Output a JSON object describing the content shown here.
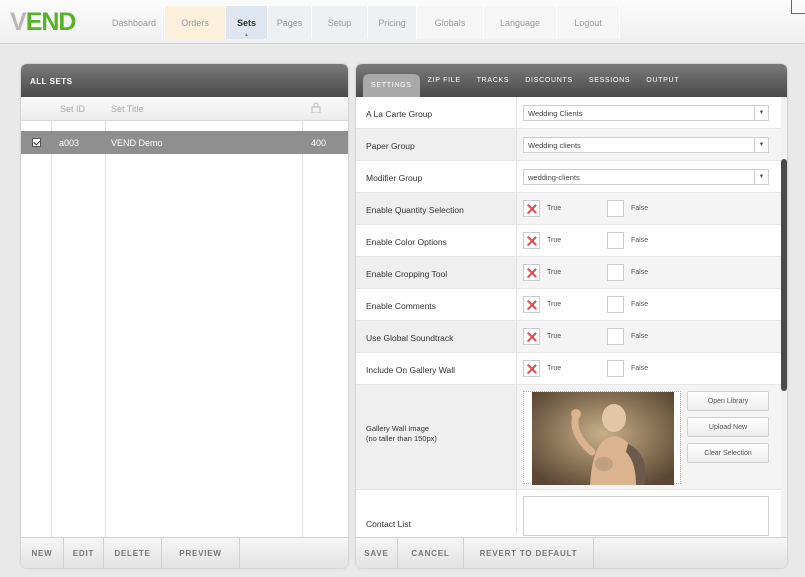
{
  "app": {
    "logo_v": "V",
    "logo_rest": "END"
  },
  "nav": {
    "tabs": [
      {
        "label": "Dashboard"
      },
      {
        "label": "Orders"
      },
      {
        "label": "Sets"
      },
      {
        "label": "Pages"
      },
      {
        "label": "Setup"
      },
      {
        "label": "Pricing"
      },
      {
        "label": "Globals"
      },
      {
        "label": "Language"
      },
      {
        "label": "Logout"
      }
    ],
    "active": "Sets"
  },
  "sets_panel": {
    "title": "ALL SETS",
    "columns": {
      "id": "Set ID",
      "title": "Set Title"
    },
    "rows": [
      {
        "id": "a003",
        "title": "VEND Demo",
        "count": "400",
        "checked": true
      }
    ],
    "footer": {
      "new": "NEW",
      "edit": "EDIT",
      "delete": "DELETE",
      "preview": "PREVIEW"
    }
  },
  "detail_panel": {
    "tabs": [
      "SETTINGS",
      "ZIP FILE",
      "TRACKS",
      "DISCOUNTS",
      "SESSIONS",
      "OUTPUT"
    ],
    "active_tab": "SETTINGS",
    "fields": {
      "a_la_carte": {
        "label": "A La Carte Group",
        "value": "Wedding Clients"
      },
      "paper": {
        "label": "Paper Group",
        "value": "Wedding clients"
      },
      "modifier": {
        "label": "Modifier Group",
        "value": "wedding-clients"
      },
      "true_label": "True",
      "false_label": "False",
      "toggles": [
        {
          "label": "Enable Quantity Selection",
          "value": true
        },
        {
          "label": "Enable Color Options",
          "value": true
        },
        {
          "label": "Enable Cropping Tool",
          "value": true
        },
        {
          "label": "Enable Comments",
          "value": true
        },
        {
          "label": "Use Global Soundtrack",
          "value": true
        },
        {
          "label": "Include On Gallery Wall",
          "value": true
        }
      ],
      "gallery_image": {
        "label_line1": "Gallery Wall Image",
        "label_line2": "(no taller than 150px)",
        "open_library": "Open Library",
        "upload_new": "Upload New",
        "clear_selection": "Clear Selection"
      },
      "contact_list": {
        "label": "Contact List",
        "value": ""
      }
    },
    "footer": {
      "save": "SAVE",
      "cancel": "CANCEL",
      "revert": "REVERT TO DEFAULT"
    }
  },
  "colors": {
    "brand_green": "#57b22a",
    "header_dark": "#4a4a4a",
    "check_red": "#d84b4b"
  }
}
